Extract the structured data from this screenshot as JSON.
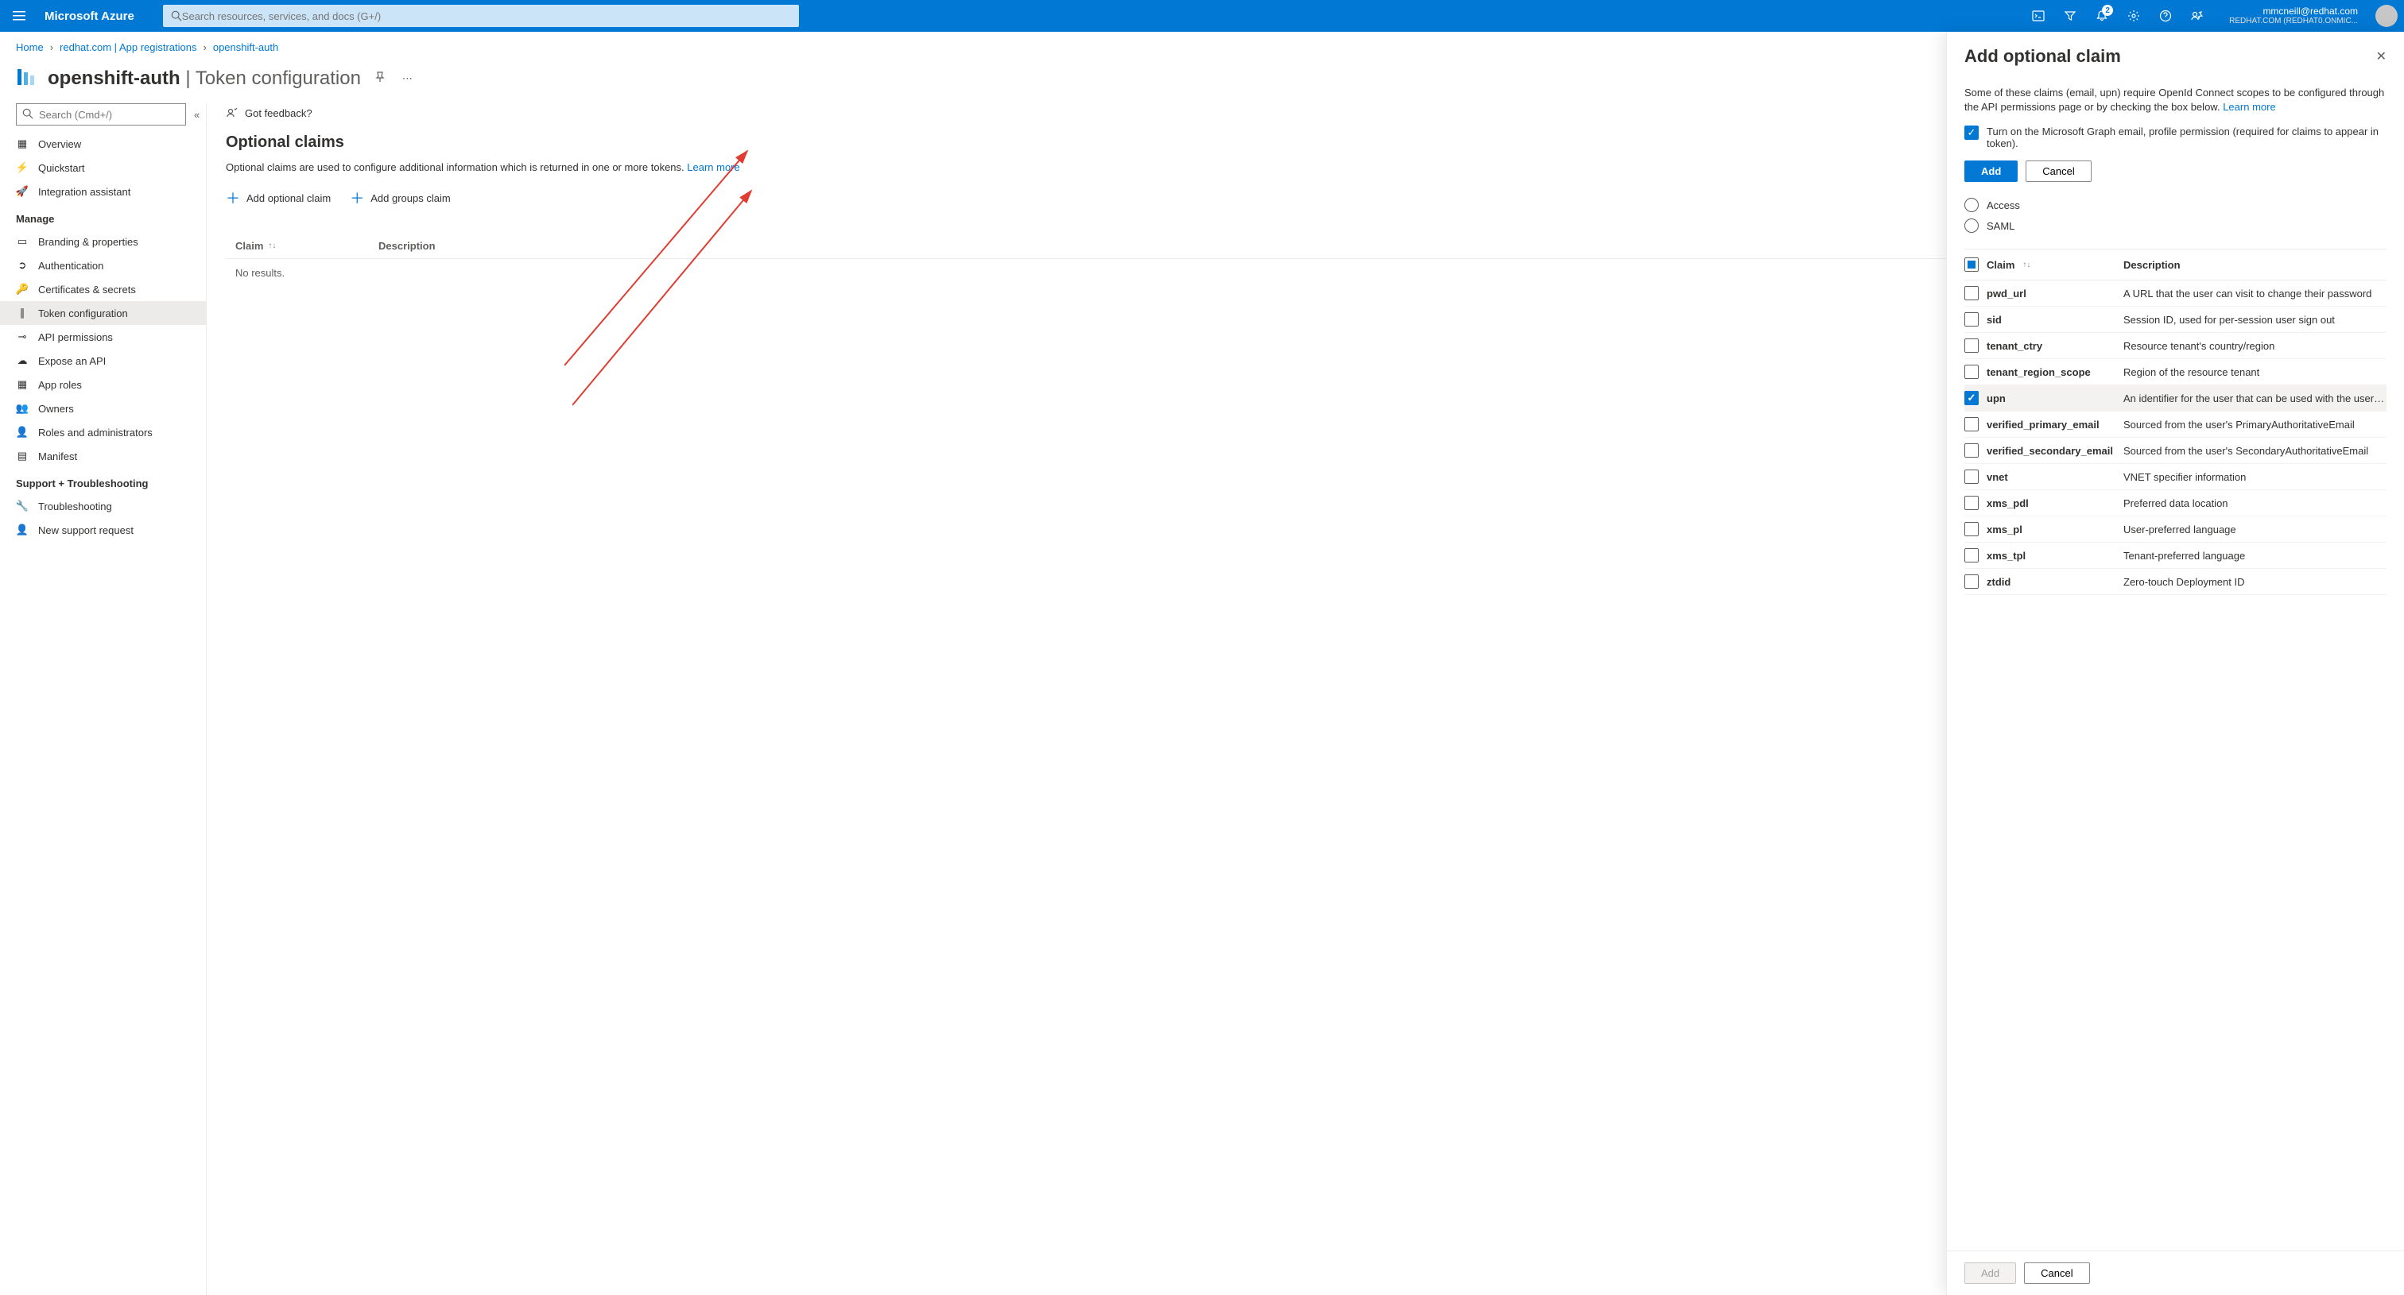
{
  "topbar": {
    "brand": "Microsoft Azure",
    "search_placeholder": "Search resources, services, and docs (G+/)",
    "notification_count": "2",
    "user_email": "mmcneill@redhat.com",
    "user_tenant": "REDHAT.COM (REDHAT0.ONMIC..."
  },
  "breadcrumb": {
    "items": [
      "Home",
      "redhat.com | App registrations",
      "openshift-auth"
    ]
  },
  "header": {
    "app_name": "openshift-auth",
    "page_name": "Token configuration"
  },
  "sidebar": {
    "search_placeholder": "Search (Cmd+/)",
    "groups": {
      "default": [
        "Overview",
        "Quickstart",
        "Integration assistant"
      ],
      "manage_label": "Manage",
      "manage": [
        "Branding & properties",
        "Authentication",
        "Certificates & secrets",
        "Token configuration",
        "API permissions",
        "Expose an API",
        "App roles",
        "Owners",
        "Roles and administrators",
        "Manifest"
      ],
      "support_label": "Support + Troubleshooting",
      "support": [
        "Troubleshooting",
        "New support request"
      ]
    },
    "active": "Token configuration"
  },
  "main": {
    "feedback": "Got feedback?",
    "section_title": "Optional claims",
    "section_desc": "Optional claims are used to configure additional information which is returned in one or more tokens. ",
    "learn_more": "Learn more",
    "actions": {
      "add_optional": "Add optional claim",
      "add_groups": "Add groups claim"
    },
    "table": {
      "col_claim": "Claim",
      "col_desc": "Description",
      "no_results": "No results."
    }
  },
  "panel": {
    "title": "Add optional claim",
    "intro": "Some of these claims (email, upn) require OpenId Connect scopes to be configured through the API permissions page or by checking the box below. ",
    "learn_more": "Learn more",
    "graph_label": "Turn on the Microsoft Graph email, profile permission (required for claims to appear in token).",
    "add_btn": "Add",
    "cancel_btn": "Cancel",
    "token_types": [
      "Access",
      "SAML"
    ],
    "col_claim": "Claim",
    "col_desc": "Description",
    "claims": [
      {
        "name": "pwd_url",
        "desc": "A URL that the user can visit to change their password",
        "checked": false
      },
      {
        "name": "sid",
        "desc": "Session ID, used for per-session user sign out",
        "checked": false
      },
      {
        "name": "tenant_ctry",
        "desc": "Resource tenant's country/region",
        "checked": false
      },
      {
        "name": "tenant_region_scope",
        "desc": "Region of the resource tenant",
        "checked": false
      },
      {
        "name": "upn",
        "desc": "An identifier for the user that can be used with the userna...",
        "checked": true
      },
      {
        "name": "verified_primary_email",
        "desc": "Sourced from the user's PrimaryAuthoritativeEmail",
        "checked": false
      },
      {
        "name": "verified_secondary_email",
        "desc": "Sourced from the user's SecondaryAuthoritativeEmail",
        "checked": false
      },
      {
        "name": "vnet",
        "desc": "VNET specifier information",
        "checked": false
      },
      {
        "name": "xms_pdl",
        "desc": "Preferred data location",
        "checked": false
      },
      {
        "name": "xms_pl",
        "desc": "User-preferred language",
        "checked": false
      },
      {
        "name": "xms_tpl",
        "desc": "Tenant-preferred language",
        "checked": false
      },
      {
        "name": "ztdid",
        "desc": "Zero-touch Deployment ID",
        "checked": false
      }
    ],
    "footer_add": "Add",
    "footer_cancel": "Cancel"
  }
}
